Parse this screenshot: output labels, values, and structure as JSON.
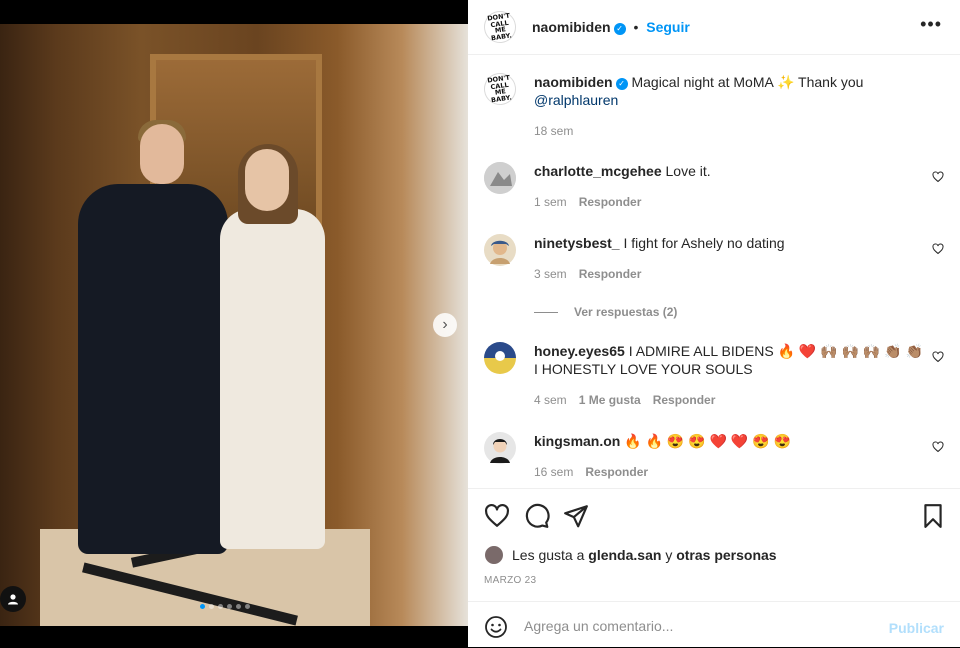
{
  "post": {
    "author": "naomibiden",
    "follow_label": "Seguir",
    "more_icon": "more-horizontal-icon",
    "caption_text": "Magical night at MoMA ✨ Thank you",
    "caption_mention": "@ralphlauren",
    "caption_time": "18 sem",
    "logo_lines": [
      "DON'T",
      "CALL ME",
      "BABY."
    ]
  },
  "comments": [
    {
      "user": "charlotte_mcgehee",
      "text": "Love it.",
      "time": "1 sem",
      "likes": "",
      "reply": "Responder",
      "avatar_color": "#d9d9d9"
    },
    {
      "user": "ninetysbest_",
      "text": "I fight for Ashely no dating",
      "time": "3 sem",
      "likes": "",
      "reply": "Responder",
      "avatar_color": "#c9b08a"
    },
    {
      "user": "honey.eyes65",
      "text": "I ADMIRE ALL BIDENS 🔥 ❤️ 🙌🏽 🙌🏽 🙌🏽 👏🏽 👏🏽 I HONESTLY LOVE YOUR SOULS",
      "time": "4 sem",
      "likes": "1 Me gusta",
      "reply": "Responder",
      "avatar_color": "#2a4a8a"
    },
    {
      "user": "kingsman.on",
      "text": "🔥 🔥 😍 😍 ❤️ ❤️ 😍 😍",
      "time": "16 sem",
      "likes": "",
      "reply": "Responder",
      "avatar_color": "#e0e0e0"
    }
  ],
  "view_replies": "Ver respuestas (2)",
  "likes": {
    "prefix": "Les gusta a",
    "user": "glenda.san",
    "connector": "y",
    "others": "otras personas"
  },
  "date": "MARZO 23",
  "comment_box": {
    "placeholder": "Agrega un comentario...",
    "publish_label": "Publicar"
  },
  "media": {
    "carousel_count": 6,
    "carousel_active": 1
  },
  "colors": {
    "accent": "#0095f6",
    "link": "#00376b",
    "muted": "#8e8e8e"
  }
}
